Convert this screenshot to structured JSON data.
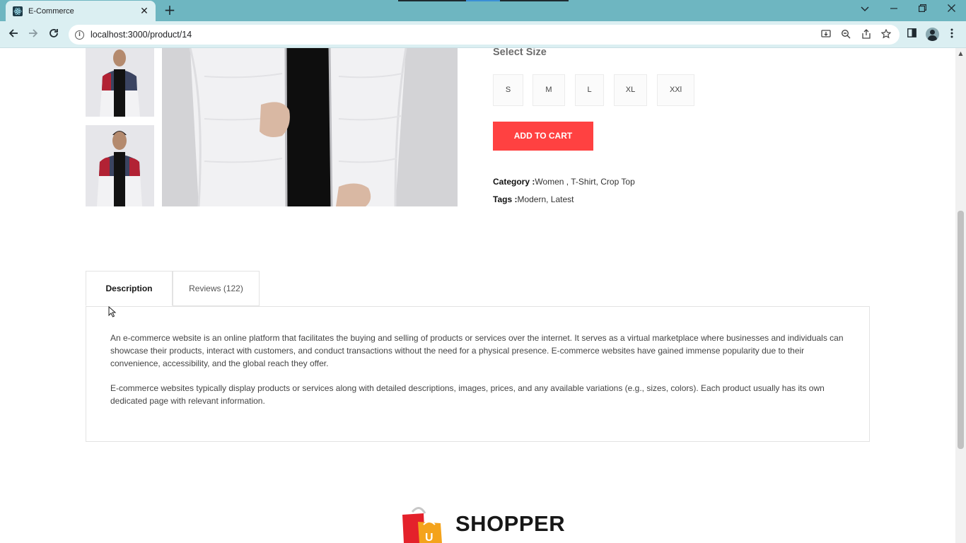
{
  "browser": {
    "tab_title": "E-Commerce",
    "tab_close": "✕",
    "new_tab": "+",
    "url": "localhost:3000/product/14",
    "colors": {
      "tabbar": "#6eb6c1",
      "toolbar": "#dbeff2"
    }
  },
  "icons": {
    "back": "back-arrow-icon",
    "forward": "forward-arrow-icon",
    "reload": "reload-icon",
    "site_info": "info-icon",
    "install": "install-app-icon",
    "zoom": "zoom-icon",
    "share": "share-icon",
    "bookmark": "star-icon",
    "side_panel": "side-panel-icon",
    "profile": "profile-avatar-icon",
    "menu": "kebab-menu-icon"
  },
  "product": {
    "select_size_label": "Select Size",
    "sizes": [
      "S",
      "M",
      "L",
      "XL",
      "XXl"
    ],
    "add_to_cart": "ADD TO CART",
    "category_label": "Category :",
    "category_value": "Women , T-Shirt, Crop Top",
    "tags_label": "Tags :",
    "tags_value": "Modern, Latest",
    "accent_color": "#ff4141"
  },
  "tabs": {
    "description": "Description",
    "reviews": "Reviews (122)"
  },
  "description": {
    "paragraph_1": "An e-commerce website is an online platform that facilitates the buying and selling of products or services over the internet. It serves as a virtual marketplace where businesses and individuals can showcase their products, interact with customers, and conduct transactions without the need for a physical presence. E-commerce websites have gained immense popularity due to their convenience, accessibility, and the global reach they offer.",
    "paragraph_2": "E-commerce websites typically display products or services along with detailed descriptions, images, prices, and any available variations (e.g., sizes, colors). Each product usually has its own dedicated page with relevant information."
  },
  "footer": {
    "brand": "SHOPPER"
  }
}
